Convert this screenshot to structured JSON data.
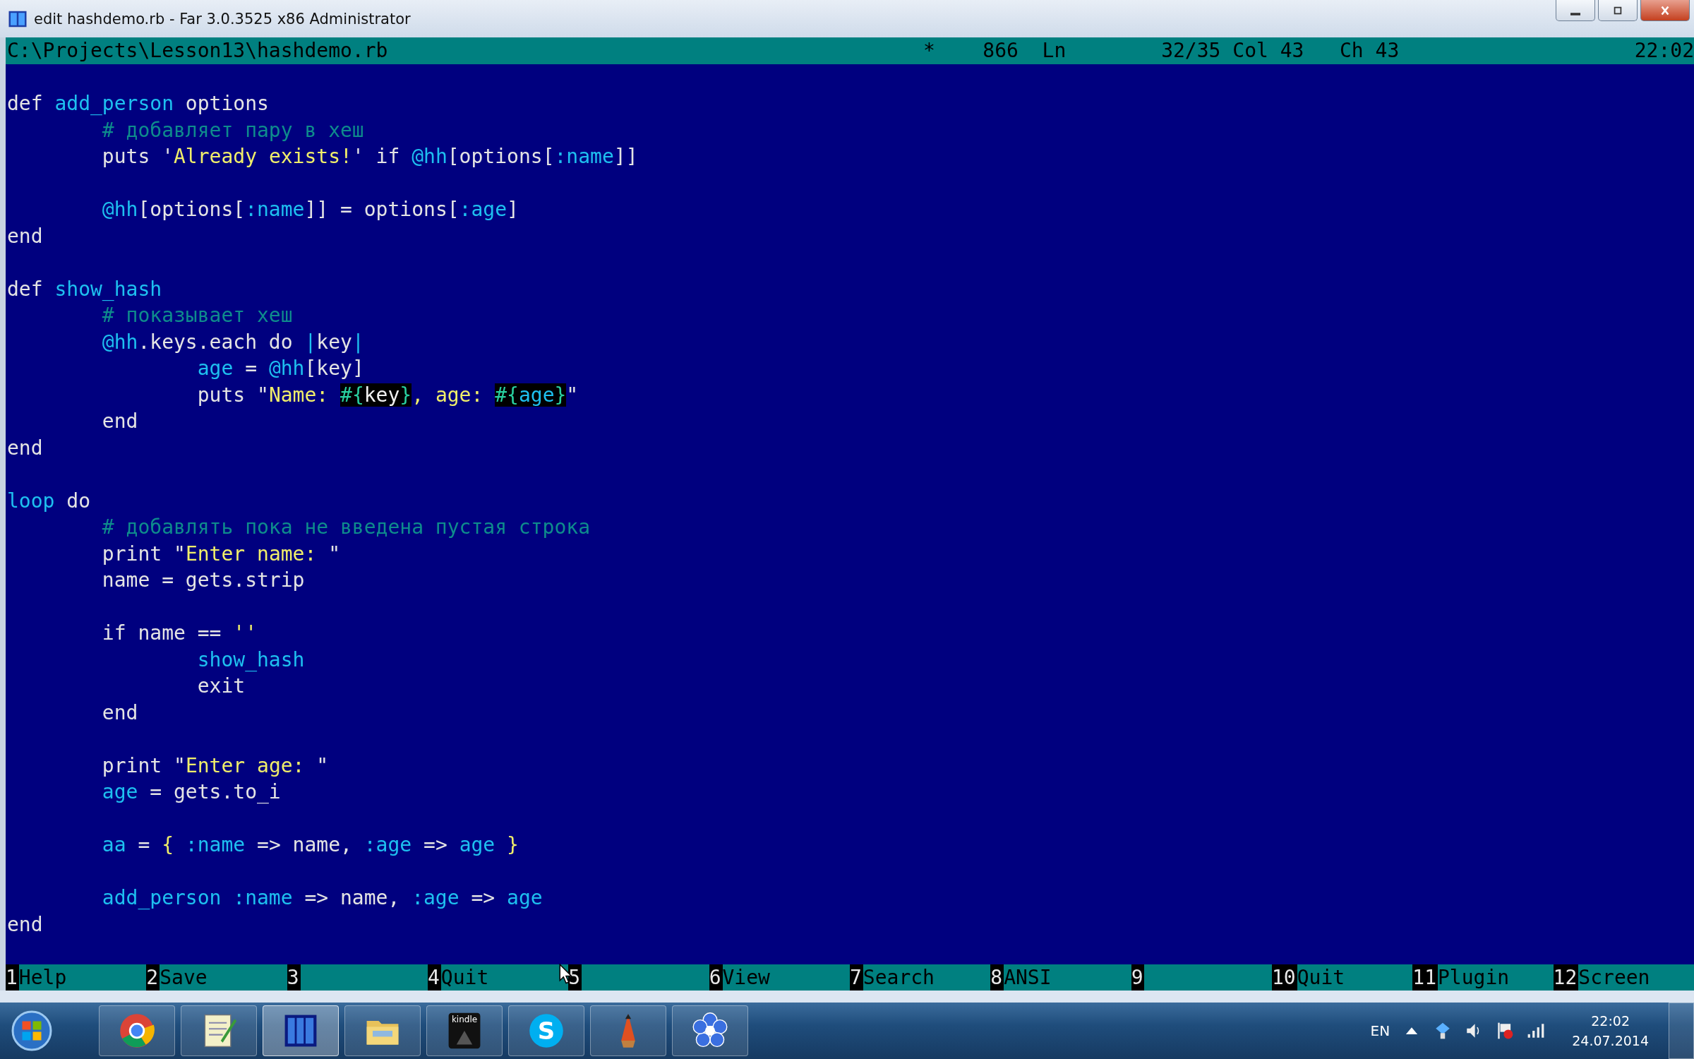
{
  "window": {
    "title": "edit hashdemo.rb - Far 3.0.3525 x86 Administrator"
  },
  "status_bar": {
    "path": "C:\\Projects\\Lesson13\\hashdemo.rb",
    "modified": "*",
    "size": "866",
    "ln_label": "Ln",
    "line": "32/35",
    "col_label": "Col",
    "col": "43",
    "ch_label": "Ch",
    "ch": "43",
    "clock": "22:02"
  },
  "lines": [
    {
      "kind": "blank"
    },
    {
      "kind": "code",
      "tokens": [
        {
          "kind": "plain",
          "text": "def "
        },
        {
          "kind": "ident",
          "text": "add_person"
        },
        {
          "kind": "plain",
          "text": " options"
        }
      ],
      "children": [
        {
          "kind": "code",
          "tokens": [
            {
              "kind": "comment",
              "text": "# добавляет пару в хеш"
            }
          ]
        },
        {
          "kind": "code",
          "tokens": [
            {
              "kind": "plain",
              "text": "puts '"
            },
            {
              "kind": "string",
              "text": "Already exists!"
            },
            {
              "kind": "plain",
              "text": "' if "
            },
            {
              "kind": "ident",
              "text": "@hh"
            },
            {
              "kind": "plain",
              "text": "[options["
            },
            {
              "kind": "ident",
              "text": ":name"
            },
            {
              "kind": "plain",
              "text": "]]"
            }
          ]
        },
        {
          "kind": "blank"
        },
        {
          "kind": "code",
          "tokens": [
            {
              "kind": "ident",
              "text": "@hh"
            },
            {
              "kind": "plain",
              "text": "[options["
            },
            {
              "kind": "ident",
              "text": ":name"
            },
            {
              "kind": "plain",
              "text": "]] = options["
            },
            {
              "kind": "ident",
              "text": ":age"
            },
            {
              "kind": "plain",
              "text": "]"
            }
          ]
        }
      ]
    },
    {
      "kind": "code",
      "tokens": [
        {
          "kind": "plain",
          "text": "end"
        }
      ]
    },
    {
      "kind": "blank"
    },
    {
      "kind": "code",
      "tokens": [
        {
          "kind": "plain",
          "text": "def "
        },
        {
          "kind": "ident",
          "text": "show_hash"
        }
      ],
      "children": [
        {
          "kind": "code",
          "tokens": [
            {
              "kind": "comment",
              "text": "# показывает хеш"
            }
          ]
        },
        {
          "kind": "code",
          "tokens": [
            {
              "kind": "ident",
              "text": "@hh"
            },
            {
              "kind": "plain",
              "text": ".keys.each do "
            },
            {
              "kind": "ident",
              "text": "|"
            },
            {
              "kind": "plain",
              "text": "key"
            },
            {
              "kind": "ident",
              "text": "|"
            }
          ],
          "children": [
            {
              "kind": "code",
              "tokens": [
                {
                  "kind": "ident",
                  "text": "age"
                },
                {
                  "kind": "plain",
                  "text": " = "
                },
                {
                  "kind": "ident",
                  "text": "@hh"
                },
                {
                  "kind": "plain",
                  "text": "[key]"
                }
              ]
            },
            {
              "kind": "code",
              "tokens": [
                {
                  "kind": "plain",
                  "text": "puts \""
                },
                {
                  "kind": "string",
                  "text": "Name: "
                },
                {
                  "kind": "interp",
                  "text": "#{"
                },
                {
                  "kind": "interp-plain",
                  "text": "key"
                },
                {
                  "kind": "interp",
                  "text": "}"
                },
                {
                  "kind": "string",
                  "text": ", age: "
                },
                {
                  "kind": "interp",
                  "text": "#{"
                },
                {
                  "kind": "interp-ident",
                  "text": "age"
                },
                {
                  "kind": "interp",
                  "text": "}"
                },
                {
                  "kind": "plain",
                  "text": "\""
                }
              ]
            }
          ]
        },
        {
          "kind": "code",
          "tokens": [
            {
              "kind": "plain",
              "text": "end"
            }
          ]
        }
      ]
    },
    {
      "kind": "code",
      "tokens": [
        {
          "kind": "plain",
          "text": "end"
        }
      ]
    },
    {
      "kind": "blank"
    },
    {
      "kind": "code",
      "tokens": [
        {
          "kind": "ident",
          "text": "loop"
        },
        {
          "kind": "plain",
          "text": " do"
        }
      ],
      "children": [
        {
          "kind": "code",
          "tokens": [
            {
              "kind": "comment",
              "text": "# добавлять пока не введена пустая строка"
            }
          ]
        },
        {
          "kind": "code",
          "tokens": [
            {
              "kind": "plain",
              "text": "print \""
            },
            {
              "kind": "string",
              "text": "Enter name: "
            },
            {
              "kind": "plain",
              "text": "\""
            }
          ]
        },
        {
          "kind": "code",
          "tokens": [
            {
              "kind": "plain",
              "text": "name = gets.strip"
            }
          ]
        },
        {
          "kind": "blank"
        },
        {
          "kind": "code",
          "tokens": [
            {
              "kind": "plain",
              "text": "if name == "
            },
            {
              "kind": "string",
              "text": "''"
            }
          ],
          "children": [
            {
              "kind": "code",
              "tokens": [
                {
                  "kind": "ident",
                  "text": "show_hash"
                }
              ]
            },
            {
              "kind": "code",
              "tokens": [
                {
                  "kind": "plain",
                  "text": "exit"
                }
              ]
            }
          ]
        },
        {
          "kind": "code",
          "tokens": [
            {
              "kind": "plain",
              "text": "end"
            }
          ]
        },
        {
          "kind": "blank"
        },
        {
          "kind": "code",
          "tokens": [
            {
              "kind": "plain",
              "text": "print \""
            },
            {
              "kind": "string",
              "text": "Enter age: "
            },
            {
              "kind": "plain",
              "text": "\""
            }
          ]
        },
        {
          "kind": "code",
          "tokens": [
            {
              "kind": "ident",
              "text": "age"
            },
            {
              "kind": "plain",
              "text": " = gets.to_i"
            }
          ]
        },
        {
          "kind": "blank"
        },
        {
          "kind": "code",
          "tokens": [
            {
              "kind": "ident",
              "text": "aa"
            },
            {
              "kind": "plain",
              "text": " = "
            },
            {
              "kind": "string",
              "text": "{"
            },
            {
              "kind": "ident",
              "text": " :name"
            },
            {
              "kind": "plain",
              "text": " => name, "
            },
            {
              "kind": "ident",
              "text": ":age"
            },
            {
              "kind": "plain",
              "text": " => "
            },
            {
              "kind": "ident",
              "text": "age"
            },
            {
              "kind": "string",
              "text": " }"
            }
          ]
        },
        {
          "kind": "blank"
        },
        {
          "kind": "code",
          "tokens": [
            {
              "kind": "ident",
              "text": "add_person :name"
            },
            {
              "kind": "plain",
              "text": " => name, "
            },
            {
              "kind": "ident",
              "text": ":age"
            },
            {
              "kind": "plain",
              "text": " => "
            },
            {
              "kind": "ident",
              "text": "age"
            }
          ]
        }
      ]
    },
    {
      "kind": "code",
      "tokens": [
        {
          "kind": "plain",
          "text": "end"
        }
      ]
    }
  ],
  "keybar": [
    {
      "number": "1",
      "label": "Help"
    },
    {
      "number": "2",
      "label": "Save"
    },
    {
      "number": "3"
    },
    {
      "number": "4",
      "label": "Quit"
    },
    {
      "number": "5"
    },
    {
      "number": "6",
      "label": "View"
    },
    {
      "number": "7",
      "label": "Search"
    },
    {
      "number": "8",
      "label": "ANSI"
    },
    {
      "number": "9"
    },
    {
      "number": "10",
      "label": "Quit"
    },
    {
      "number": "11",
      "label": "Plugin"
    },
    {
      "number": "12",
      "label": "Screen"
    }
  ],
  "taskbar": {
    "apps": [
      {
        "kind": "browser",
        "selected": false
      },
      {
        "kind": "notepad",
        "selected": false
      },
      {
        "kind": "far",
        "selected": true
      },
      {
        "kind": "folder",
        "selected": false
      },
      {
        "kind": "kindle",
        "label": "kindle",
        "selected": false
      },
      {
        "kind": "skype",
        "label": "S",
        "selected": false
      },
      {
        "kind": "pencil",
        "selected": false
      },
      {
        "kind": "flower",
        "selected": false
      }
    ],
    "language": "EN",
    "time": "22:02",
    "date": "24.07.2014"
  }
}
